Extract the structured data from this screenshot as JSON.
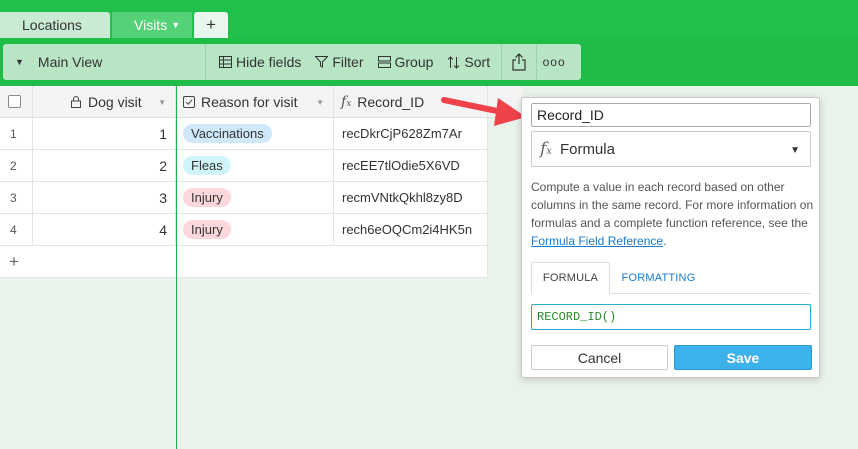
{
  "tabs": {
    "locations": "Locations",
    "visits": "Visits",
    "add": "+"
  },
  "toolbar": {
    "view_name": "Main View",
    "hide_fields": "Hide fields",
    "filter": "Filter",
    "group": "Group",
    "sort": "Sort",
    "more": "ooo"
  },
  "grid": {
    "columns": {
      "dog_visit": "Dog visit",
      "reason": "Reason for visit",
      "record_id": "Record_ID"
    },
    "rows": [
      {
        "num": "1",
        "dog_visit": "1",
        "reason": "Vaccinations",
        "reason_color": "#cfe8fc",
        "record_id": "recDkrCjP628Zm7Ar"
      },
      {
        "num": "2",
        "dog_visit": "2",
        "reason": "Fleas",
        "reason_color": "#d0f5f8",
        "record_id": "recEE7tlOdie5X6VD"
      },
      {
        "num": "3",
        "dog_visit": "3",
        "reason": "Injury",
        "reason_color": "#fcd8dc",
        "record_id": "recmVNtkQkhl8zy8D"
      },
      {
        "num": "4",
        "dog_visit": "4",
        "reason": "Injury",
        "reason_color": "#fcd8dc",
        "record_id": "rech6eOQCm2i4HK5n"
      }
    ],
    "add_row": "+"
  },
  "popup": {
    "field_name": "Record_ID",
    "field_type": "Formula",
    "description": "Compute a value in each record based on other columns in the same record. For more information on formulas and a complete function reference, see the",
    "link_text": "Formula Field Reference",
    "link_suffix": ".",
    "tab_formula": "FORMULA",
    "tab_formatting": "FORMATTING",
    "formula": "RECORD_ID()",
    "cancel": "Cancel",
    "save": "Save"
  },
  "colors": {
    "brand_green": "#20c04a",
    "save_blue": "#3db1ea",
    "arrow_red": "#f0424b"
  }
}
